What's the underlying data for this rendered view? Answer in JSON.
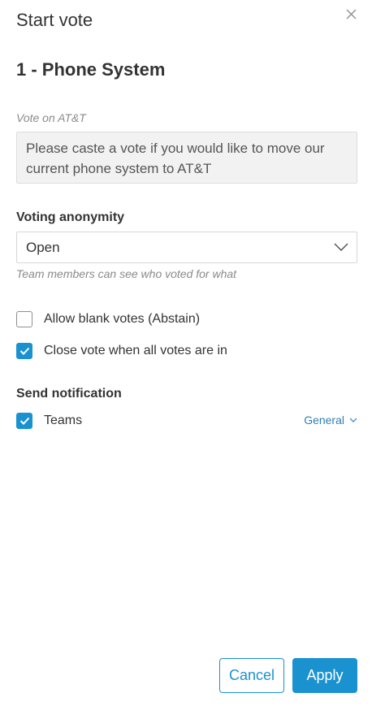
{
  "header": {
    "title": "Start vote"
  },
  "item": {
    "title": "1 - Phone System"
  },
  "vote_field": {
    "label": "Vote on AT&T",
    "text": "Please caste a vote if you would like to move our current phone system to AT&T"
  },
  "anonymity": {
    "label": "Voting anonymity",
    "selected": "Open",
    "hint": "Team members can see who voted for what"
  },
  "options": {
    "allow_blank": {
      "label": "Allow blank votes (Abstain)",
      "checked": false
    },
    "close_when_all_in": {
      "label": "Close vote when all votes are in",
      "checked": true
    }
  },
  "notification": {
    "label": "Send notification",
    "teams": {
      "label": "Teams",
      "checked": true
    },
    "channel": "General"
  },
  "footer": {
    "cancel_label": "Cancel",
    "apply_label": "Apply"
  },
  "colors": {
    "accent": "#1a92d0",
    "link": "#2f7fb3",
    "text": "#333333",
    "muted": "#8a8a8a"
  },
  "icons": {
    "close": "close-icon",
    "dropdown": "chevron-down-icon",
    "check": "checkmark-icon"
  }
}
